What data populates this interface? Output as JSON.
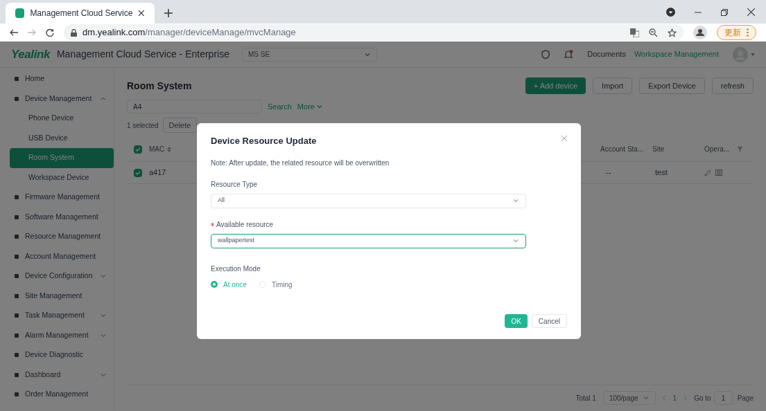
{
  "browser": {
    "tab_title": "Management Cloud Service",
    "url_host": "dm.yealink.com",
    "url_path": "/manager/deviceManage/mvcManage",
    "update_button": "更新"
  },
  "header": {
    "logo": "Yealink",
    "title": "Management Cloud Service - Enterprise",
    "org_select": "MS SE",
    "links": [
      "Documents",
      "Workspace Management"
    ]
  },
  "sidebar": {
    "items": [
      {
        "label": "Home",
        "kind": "link",
        "selected": false
      },
      {
        "label": "Device Management",
        "kind": "group",
        "selected": false,
        "expanded": true,
        "children": [
          {
            "label": "Phone Device",
            "selected": false
          },
          {
            "label": "USB Device",
            "selected": false
          },
          {
            "label": "Room System",
            "selected": true
          },
          {
            "label": "Workspace Device",
            "selected": false
          }
        ]
      },
      {
        "label": "Firmware Management",
        "kind": "link",
        "selected": false
      },
      {
        "label": "Software Management",
        "kind": "link",
        "selected": false
      },
      {
        "label": "Resource Management",
        "kind": "link",
        "selected": false
      },
      {
        "label": "Account Management",
        "kind": "link",
        "selected": false
      },
      {
        "label": "Device Configuration",
        "kind": "group",
        "selected": false,
        "expanded": false
      },
      {
        "label": "Site Management",
        "kind": "link",
        "selected": false
      },
      {
        "label": "Task Management",
        "kind": "group",
        "selected": false,
        "expanded": false
      },
      {
        "label": "Alarm Management",
        "kind": "group",
        "selected": false,
        "expanded": false
      },
      {
        "label": "Device Diagnostic",
        "kind": "link",
        "selected": false
      },
      {
        "label": "Dashboard",
        "kind": "group",
        "selected": false,
        "expanded": false
      },
      {
        "label": "Order Management",
        "kind": "link",
        "selected": false
      }
    ]
  },
  "page": {
    "title": "Room System",
    "actions": [
      "+ Add device",
      "Import",
      "Export Device",
      "refresh"
    ],
    "search": {
      "value": "A4",
      "button": "Search",
      "more": "More"
    },
    "selection": {
      "count": "1 selected",
      "delete": "Delete"
    },
    "table": {
      "header_checked": true,
      "columns": [
        "MAC",
        "Account Sta...",
        "Site",
        "Opera..."
      ],
      "rows": [
        {
          "checked": true,
          "cells": [
            "a417",
            "--",
            "test"
          ]
        }
      ]
    },
    "pagination": {
      "total": "Total 1",
      "page_size": "100/page",
      "current": "1",
      "goto_label": "Go to",
      "goto_value": "1",
      "page_label": "Page"
    }
  },
  "dialog": {
    "title": "Device Resource Update",
    "note": "Note: After update, the related resource will be overwritten",
    "fields": [
      {
        "label": "Resource Type",
        "required": false,
        "value": "All",
        "focused": false
      },
      {
        "label": "Available resource",
        "required": true,
        "value": "wallpapertest",
        "focused": true
      }
    ],
    "mode_label": "Execution Mode",
    "modes": [
      {
        "label": "At once",
        "selected": true
      },
      {
        "label": "Timing",
        "selected": false
      }
    ],
    "buttons": [
      "OK",
      "Cancel"
    ]
  }
}
